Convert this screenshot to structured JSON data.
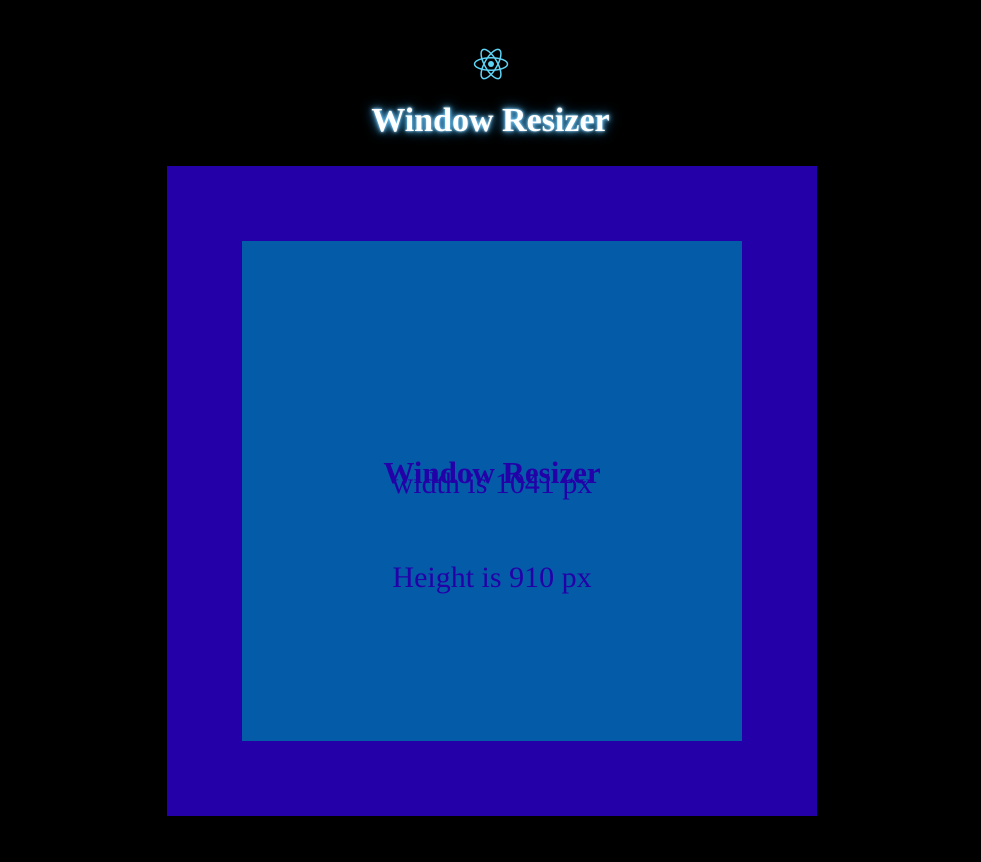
{
  "header": {
    "logo_icon": "react-atom-icon",
    "title": "Window Resizer"
  },
  "card": {
    "title": "Window Resizer",
    "width_text": "width is 1041 px",
    "height_text": "Height is 910 px"
  },
  "colors": {
    "background": "#000000",
    "outer_box": "#2300a8",
    "inner_box": "#045ba8",
    "logo": "#5ed3f3",
    "inner_text": "#2300a8"
  }
}
